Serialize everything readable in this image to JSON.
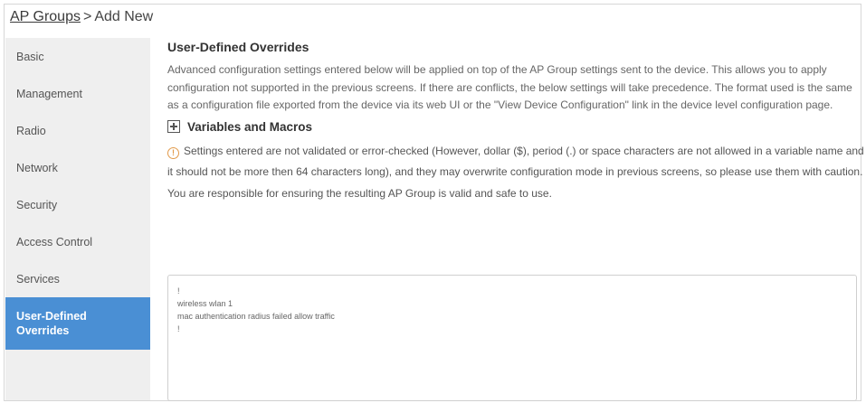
{
  "breadcrumb": {
    "parent": "AP Groups",
    "separator": ">",
    "current": "Add New"
  },
  "sidebar": {
    "items": [
      {
        "label": "Basic"
      },
      {
        "label": "Management"
      },
      {
        "label": "Radio"
      },
      {
        "label": "Network"
      },
      {
        "label": "Security"
      },
      {
        "label": "Access Control"
      },
      {
        "label": "Services"
      },
      {
        "label": "User-Defined Overrides"
      }
    ],
    "active_index": 7
  },
  "main": {
    "title": "User-Defined Overrides",
    "description": "Advanced configuration settings entered below will be applied on top of the AP Group settings sent to the device. This allows you to apply configuration not supported in the previous screens. If there are conflicts, the below settings will take precedence. The format used is the same as a configuration file exported from the device via its web UI or the \"View Device Configuration\" link in the device level configuration page.",
    "variables_label": "Variables and Macros",
    "warning_icon": "warning-circle-icon",
    "warning_text": "Settings entered are not validated or error-checked (However, dollar ($), period (.) or space characters are not allowed in a variable name and it should not be more then 64 characters long), and they may overwrite configuration mode in previous screens, so please use them with caution. You are responsible for ensuring the resulting AP Group is valid and safe to use.",
    "config_lines": [
      "!",
      "wireless wlan 1",
      "mac authentication radius failed allow traffic",
      "!"
    ]
  },
  "colors": {
    "active_nav": "#4a8fd4",
    "sidebar_bg": "#efefef",
    "warning": "#e29a4a"
  }
}
